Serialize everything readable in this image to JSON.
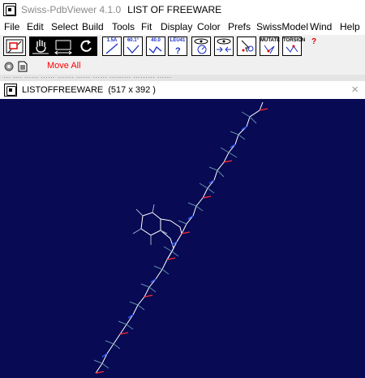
{
  "app": {
    "name": "Swiss-PdbViewer 4.1.0",
    "document": "LIST OF FREEWARE"
  },
  "menu": [
    "File",
    "Edit",
    "Select",
    "Build",
    "Tools",
    "Fit",
    "Display",
    "Color",
    "Prefs",
    "SwissModel",
    "Wind",
    "Help"
  ],
  "toolbar": {
    "buttons": [
      {
        "name": "measure-distance-button",
        "label": "1.5Å"
      },
      {
        "name": "measure-angle-button",
        "label": "60.1°"
      },
      {
        "name": "measure-torsion-button",
        "label": "40.0"
      },
      {
        "name": "identify-residue-button",
        "label": "LEU41"
      },
      {
        "name": "center-button",
        "label": ""
      },
      {
        "name": "neighbors-button",
        "label": ""
      },
      {
        "name": "mutate-button",
        "label": "MUTATE"
      },
      {
        "name": "torsion-button",
        "label": "TORSION"
      }
    ],
    "help_symbol": "?"
  },
  "row2": {
    "move_all_label": "Move All"
  },
  "strip_text": "…  ….  …… ……  ……. …… ……  ………  ……… ……",
  "viewer_window": {
    "title": "LISTOFFREEWARE",
    "size_text": "(517 x 392 )",
    "close_symbol": "×"
  },
  "colors": {
    "viewer_background": "#080a54",
    "carbon": "#ffffff",
    "nitrogen": "#2e5bff",
    "oxygen": "#ff2a2a",
    "hydrogen": "#5f8ea8",
    "move_all_text": "#ff0000"
  }
}
